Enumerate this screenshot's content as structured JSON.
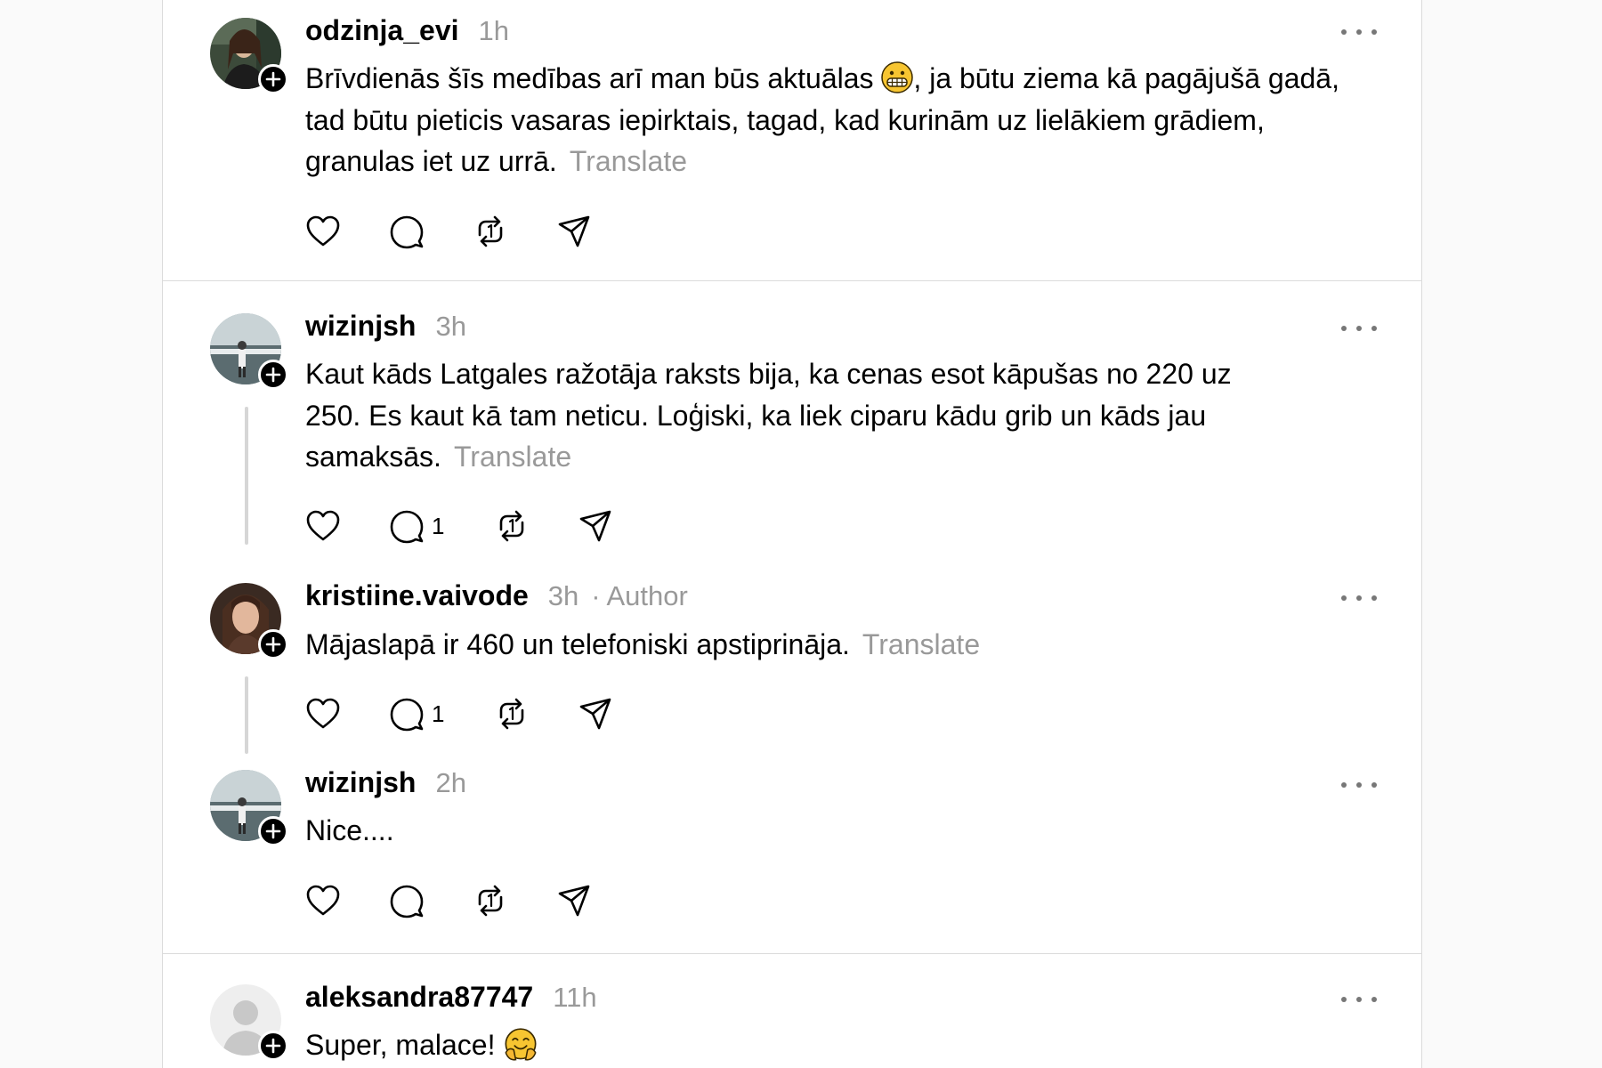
{
  "posts": [
    {
      "username": "odzinja_evi",
      "time": "1h",
      "body_before_emoji": "Brīvdienās šīs medības arī man būs aktuālas ",
      "body_after_emoji": ", ja būtu ziema kā pagājušā gadā, tad būtu pieticis vasaras iepirktais, tagad, kad kurinām uz lielākiem grādiem, granulas iet uz urrā.",
      "emoji": "grimacing-face",
      "translate": "Translate",
      "reply_count": ""
    },
    {
      "username": "wizinjsh",
      "time": "3h",
      "body": "Kaut kāds Latgales ražotāja raksts bija, ka cenas esot kāpušas no 220 uz 250. Es kaut kā tam neticu. Loģiski, ka liek ciparu kādu grib un kāds jau samaksās.",
      "translate": "Translate",
      "reply_count": "1"
    },
    {
      "username": "kristiine.vaivode",
      "time": "3h",
      "author_tag": "· Author",
      "body": "Mājaslapā ir 460 un telefoniski apstiprināja.",
      "translate": "Translate",
      "reply_count": "1"
    },
    {
      "username": "wizinjsh",
      "time": "2h",
      "body": "Nice....",
      "reply_count": ""
    },
    {
      "username": "aleksandra87747",
      "time": "11h",
      "body": "Super, malace! ",
      "emoji": "smiling-face-with-open-hands"
    }
  ],
  "icons": {
    "like": "heart-icon",
    "reply": "comment-icon",
    "repost": "repost-icon",
    "share": "send-icon",
    "more": "more-horizontal-icon",
    "follow": "plus-icon"
  },
  "colors": {
    "background": "#fafafa",
    "card": "#ffffff",
    "border": "#dbdbdb",
    "muted_text": "#999999",
    "thread_line": "#d6d6d6"
  }
}
